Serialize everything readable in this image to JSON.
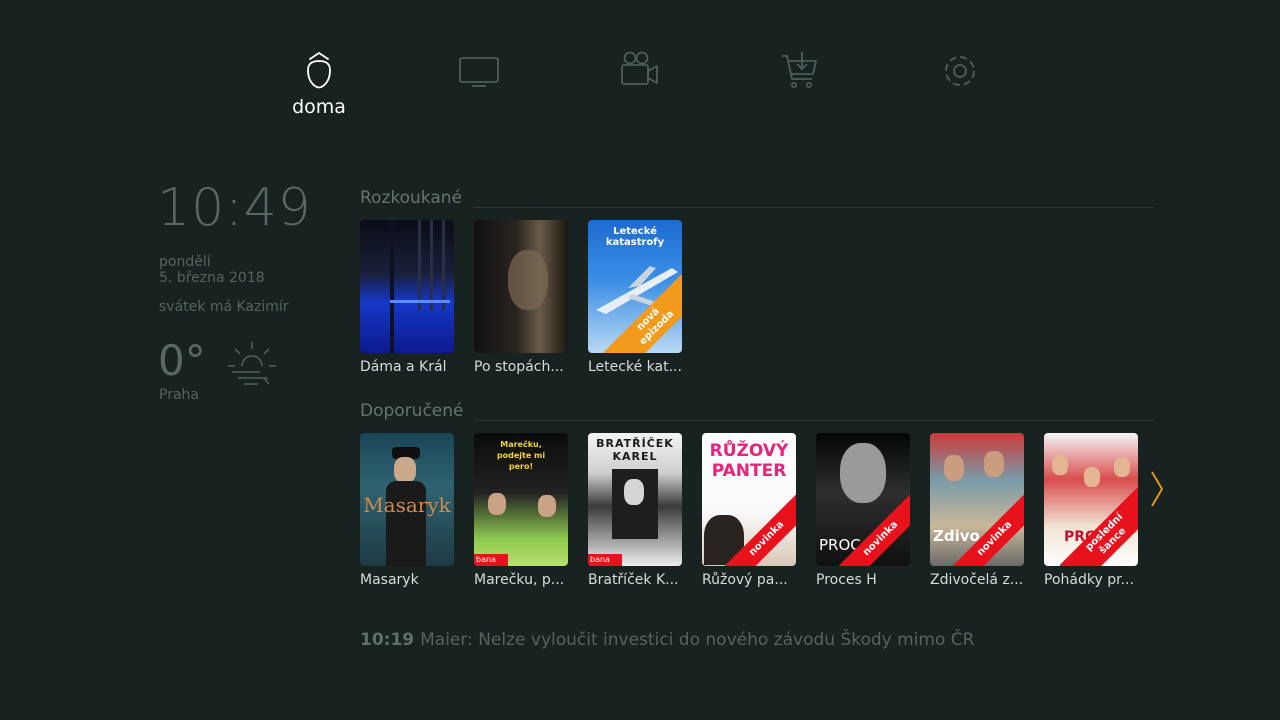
{
  "nav": {
    "items": [
      {
        "id": "home",
        "label": "doma",
        "icon": "home-icon",
        "active": true
      },
      {
        "id": "tv",
        "label": "",
        "icon": "tv-icon",
        "active": false
      },
      {
        "id": "video",
        "label": "",
        "icon": "video-camera-icon",
        "active": false
      },
      {
        "id": "store",
        "label": "",
        "icon": "cart-download-icon",
        "active": false
      },
      {
        "id": "settings",
        "label": "",
        "icon": "gear-icon",
        "active": false
      }
    ]
  },
  "sidebar": {
    "time": "10:49",
    "weekday": "pondělí",
    "date": "5. března 2018",
    "nameday": "svátek má Kazimír",
    "temperature": "0°",
    "city": "Praha",
    "weather_icon": "sun-haze-icon"
  },
  "rows": {
    "watching": {
      "title": "Rozkoukané",
      "items": [
        {
          "title": "Dáma a Král"
        },
        {
          "title": "Po stopách..."
        },
        {
          "title": "Letecké kat...",
          "poster_text": "Letecké katastrofy",
          "badge": {
            "l1": "nová",
            "l2": "epizoda",
            "color": "#f29a1c"
          }
        }
      ]
    },
    "recommended": {
      "title": "Doporučené",
      "items": [
        {
          "title": "Masaryk",
          "poster_text": "Masaryk"
        },
        {
          "title": "Marečku, p...",
          "poster_text": "Marečku, podejte mi pero!",
          "logo": "bana"
        },
        {
          "title": "Bratříček K...",
          "poster_text": "BRATŘÍČEK KAREL",
          "logo": "bana"
        },
        {
          "title": "Růžový pa...",
          "poster_text": "RŮŽOVÝ PANTER",
          "badge": {
            "l1": "novinka",
            "color": "#e8121c"
          }
        },
        {
          "title": "Proces H",
          "poster_text": "PROC",
          "badge": {
            "l1": "novinka",
            "color": "#e8121c"
          }
        },
        {
          "title": "Zdivočelá z...",
          "poster_text": "Zdivo",
          "badge": {
            "l1": "novinka",
            "color": "#e8121c"
          }
        },
        {
          "title": "Pohádky pr...",
          "poster_text": "PRO",
          "badge": {
            "l1": "poslední",
            "l2": "šance",
            "color": "#e8121c"
          }
        }
      ]
    }
  },
  "ticker": {
    "time": "10:19",
    "text": "Maier: Nelze vyloučit investici do nového závodu Škody mimo ČR"
  },
  "colors": {
    "background": "#182220",
    "accent": "#f29a1c",
    "badge_red": "#e8121c"
  }
}
